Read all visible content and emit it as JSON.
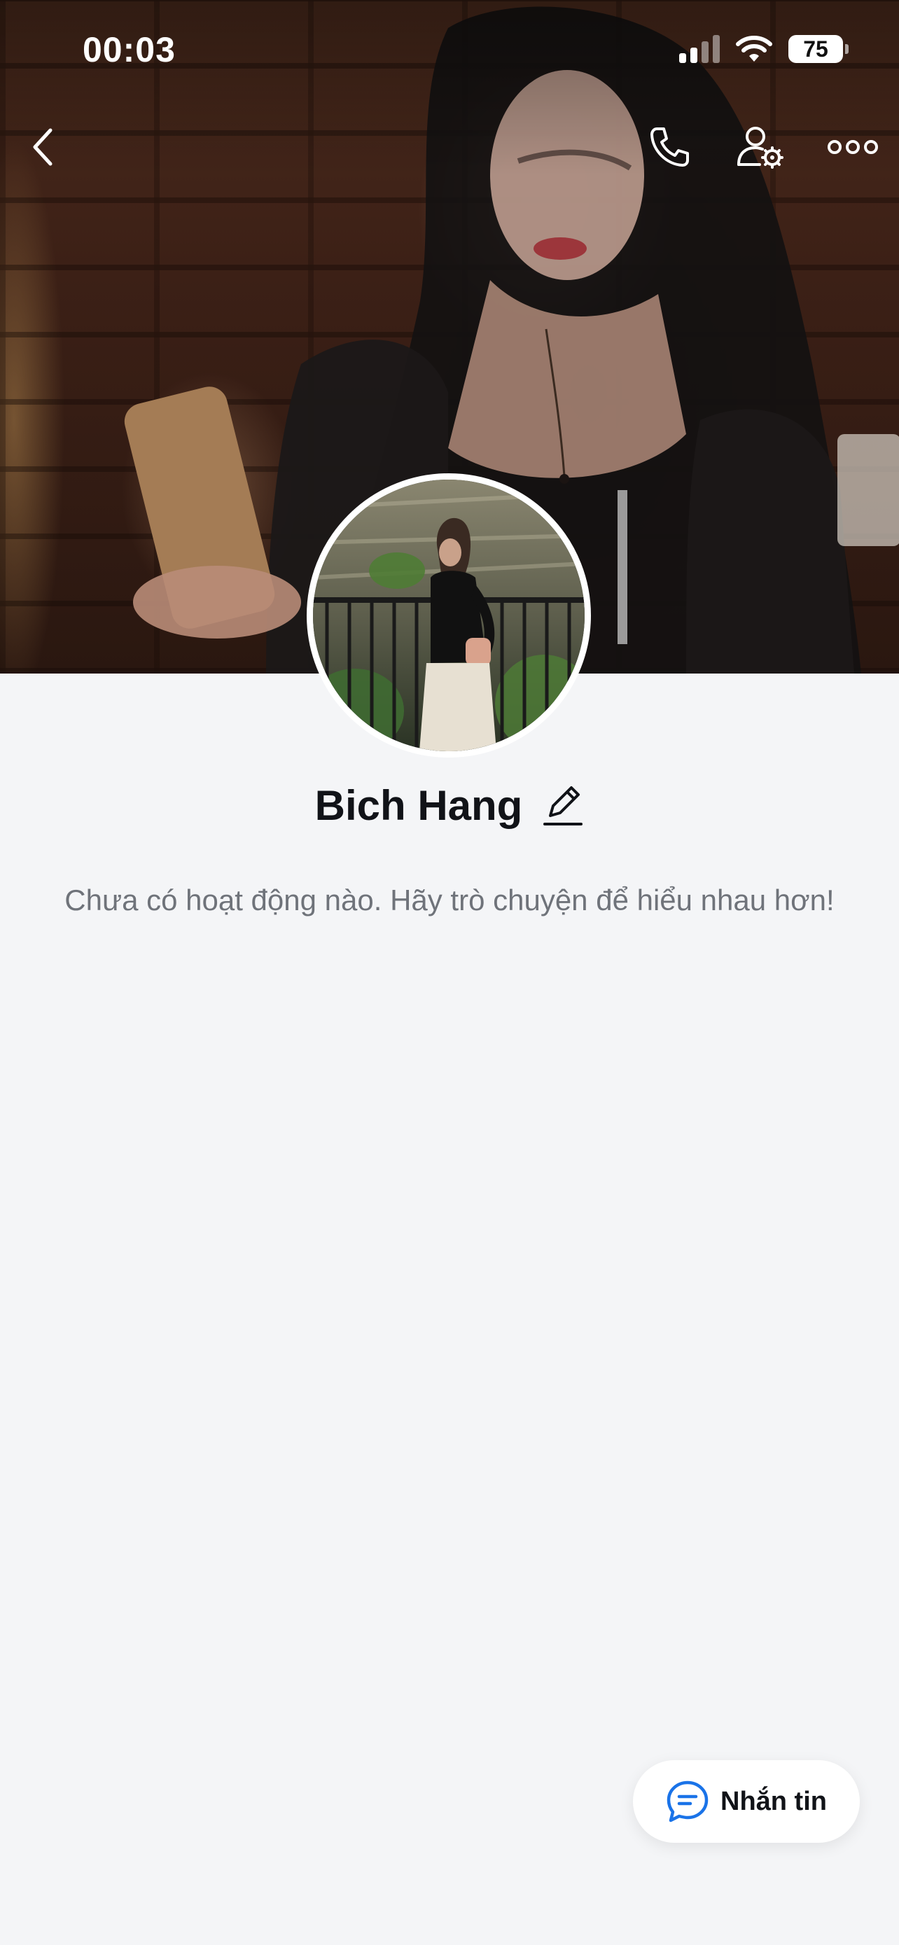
{
  "status_bar": {
    "time": "00:03",
    "battery": "75"
  },
  "profile": {
    "name": "Bich Hang",
    "empty_activity_text": "Chưa có hoạt động nào. Hãy trò chuyện để hiểu nhau hơn!"
  },
  "actions": {
    "message_label": "Nhắn tin"
  },
  "icons": {
    "back": "chevron-left-icon",
    "call": "phone-icon",
    "profile_settings": "user-gear-icon",
    "more": "more-horizontal-icon",
    "edit": "pencil-icon",
    "message": "chat-bubble-icon"
  },
  "colors": {
    "accent": "#1a73e8",
    "background": "#f4f5f7"
  }
}
